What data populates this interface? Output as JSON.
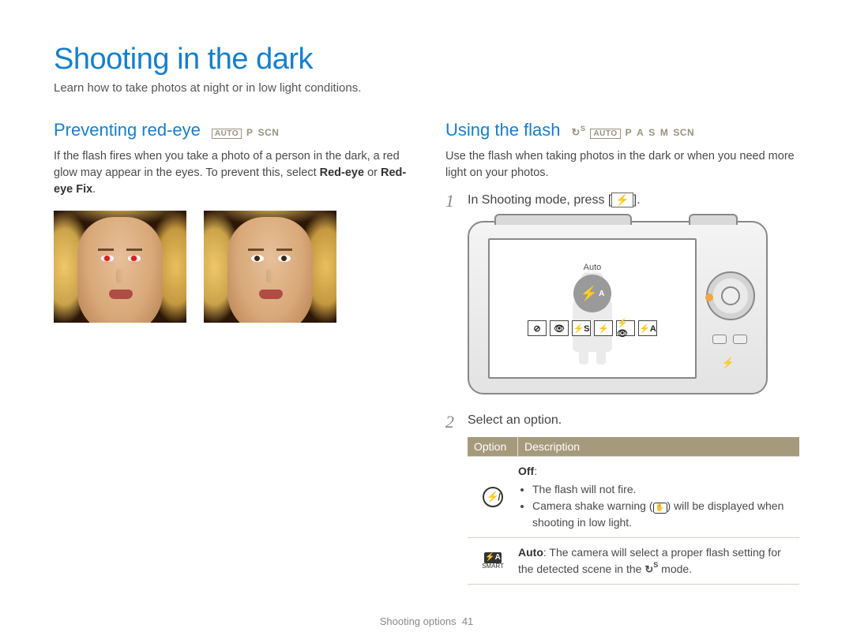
{
  "page": {
    "title": "Shooting in the dark",
    "intro": "Learn how to take photos at night or in low light conditions."
  },
  "left": {
    "heading": "Preventing red-eye",
    "modes": [
      "AUTO",
      "P",
      "SCN"
    ],
    "body_pre": "If the flash fires when you take a photo of a person in the dark, a red glow may appear in the eyes. To prevent this, select ",
    "body_bold1": "Red-eye",
    "body_mid": " or ",
    "body_bold2": "Red-eye Fix",
    "body_post": "."
  },
  "right": {
    "heading": "Using the flash",
    "modes": [
      "↻S",
      "AUTO",
      "P",
      "A",
      "S",
      "M",
      "SCN"
    ],
    "intro": "Use the flash when taking photos in the dark or when you need more light on your photos.",
    "step1_num": "1",
    "step1_pre": "In Shooting mode, press [",
    "step1_key": "⚡",
    "step1_post": "].",
    "lcd_auto_label": "Auto",
    "lcd_auto_icon": "⚡",
    "lcd_auto_sup": "A",
    "lcd_options": [
      "⊘",
      "👁",
      "⚡S",
      "⚡",
      "⚡👁",
      "⚡A"
    ],
    "step2_num": "2",
    "step2_text": "Select an option.",
    "table": {
      "head_option": "Option",
      "head_desc": "Description",
      "rows": [
        {
          "icon": "off",
          "title": "Off",
          "title_suffix": ":",
          "bullets": [
            "The flash will not fire.",
            "Camera shake warning (___SHAKE___) will be displayed when shooting in low light."
          ]
        },
        {
          "icon": "auto-scene",
          "title": "Auto",
          "title_suffix": ": ",
          "text_pre": "The camera will select a proper flash setting for the detected scene in the ",
          "text_icon": "cs",
          "text_post": " mode."
        }
      ]
    }
  },
  "footer": {
    "section": "Shooting options",
    "page_num": "41"
  }
}
